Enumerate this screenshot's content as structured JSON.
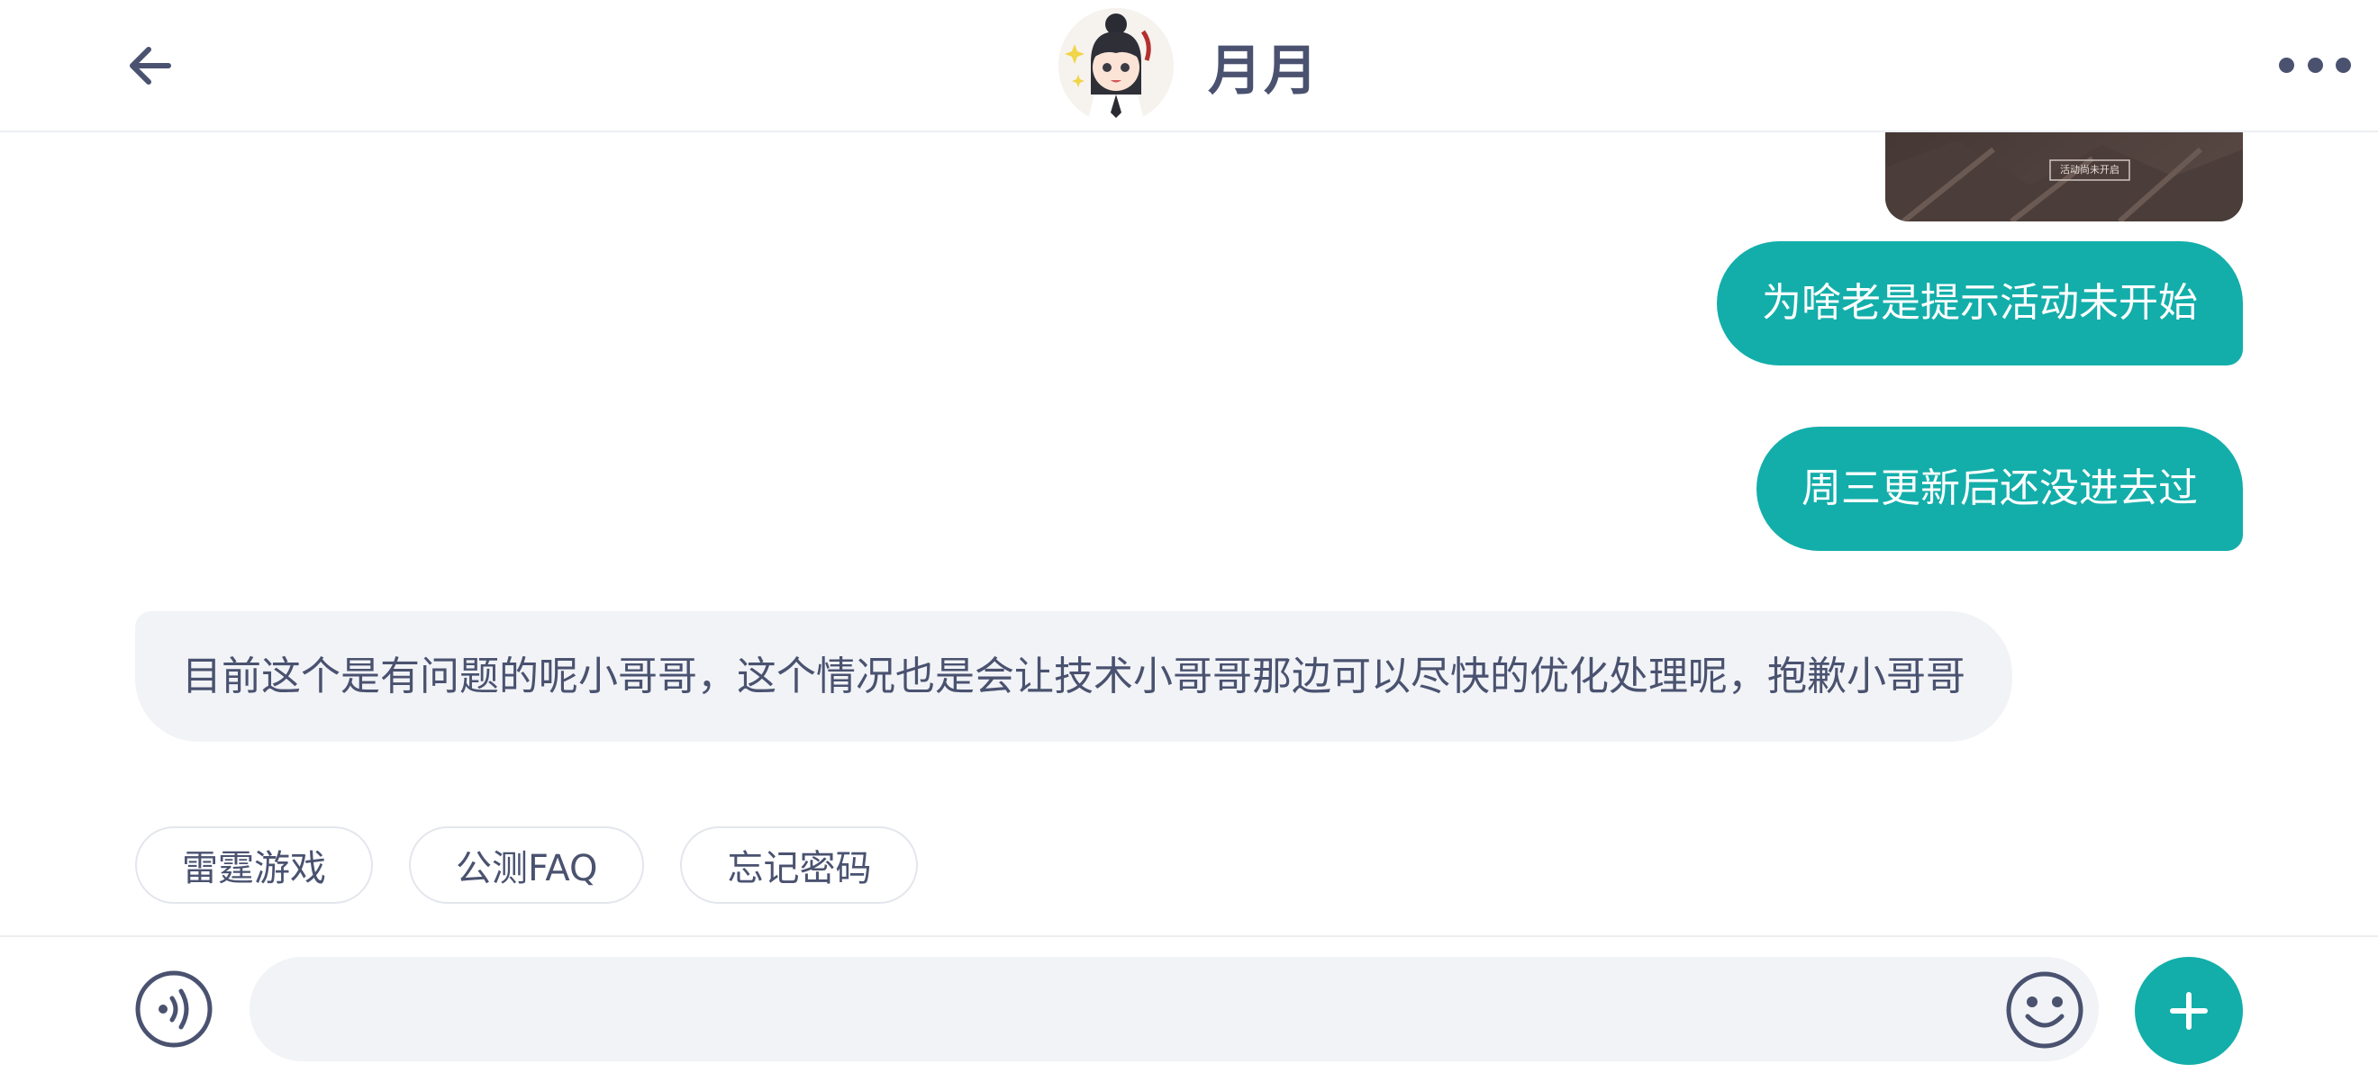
{
  "header": {
    "title": "月月",
    "back_icon": "arrow-left-icon",
    "more_icon": "more-dots-icon",
    "avatar": "character-avatar"
  },
  "image_message": {
    "caption": "活动尚未开启"
  },
  "messages": [
    {
      "from": "me",
      "text": "为啥老是提示活动未开始"
    },
    {
      "from": "me",
      "text": "周三更新后还没进去过"
    },
    {
      "from": "them",
      "text": "目前这个是有问题的呢小哥哥，这个情况也是会让技术小哥哥那边可以尽快的优化处理呢，抱歉小哥哥"
    }
  ],
  "quick_replies": [
    "雷霆游戏",
    "公测FAQ",
    "忘记密码"
  ],
  "input": {
    "placeholder": "",
    "value": "",
    "voice_icon": "voice-icon",
    "emoji_icon": "emoji-icon",
    "plus_icon": "plus-icon"
  },
  "colors": {
    "accent": "#13aeaa",
    "text": "#4a5270",
    "bubble_them": "#f1f3f6"
  }
}
